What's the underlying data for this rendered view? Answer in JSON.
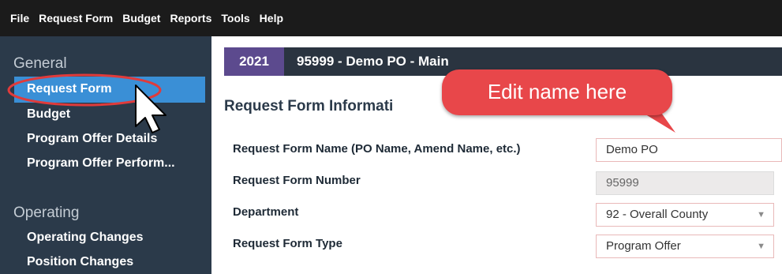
{
  "menu": {
    "items": [
      "File",
      "Request Form",
      "Budget",
      "Reports",
      "Tools",
      "Help"
    ]
  },
  "sidebar": {
    "general_header": "General",
    "general_items": [
      "Request Form",
      "Budget",
      "Program Offer Details",
      "Program Offer Perform..."
    ],
    "operating_header": "Operating",
    "operating_items": [
      "Operating Changes",
      "Position Changes"
    ]
  },
  "header": {
    "year": "2021",
    "title": "95999 - Demo PO - Main"
  },
  "section": {
    "title": "Request Form Informati"
  },
  "form": {
    "name_label": "Request Form Name (PO Name, Amend Name, etc.)",
    "name_value": "Demo PO",
    "number_label": "Request Form Number",
    "number_value": "95999",
    "department_label": "Department",
    "department_value": "92 - Overall County",
    "type_label": "Request Form Type",
    "type_value": "Program Offer"
  },
  "annotation": {
    "callout_text": "Edit name here"
  },
  "colors": {
    "menubar": "#1b1b1b",
    "sidebar": "#2b3a4a",
    "active_item": "#3a8fd6",
    "year_badge": "#5c4a8e",
    "callout": "#e8474a"
  }
}
